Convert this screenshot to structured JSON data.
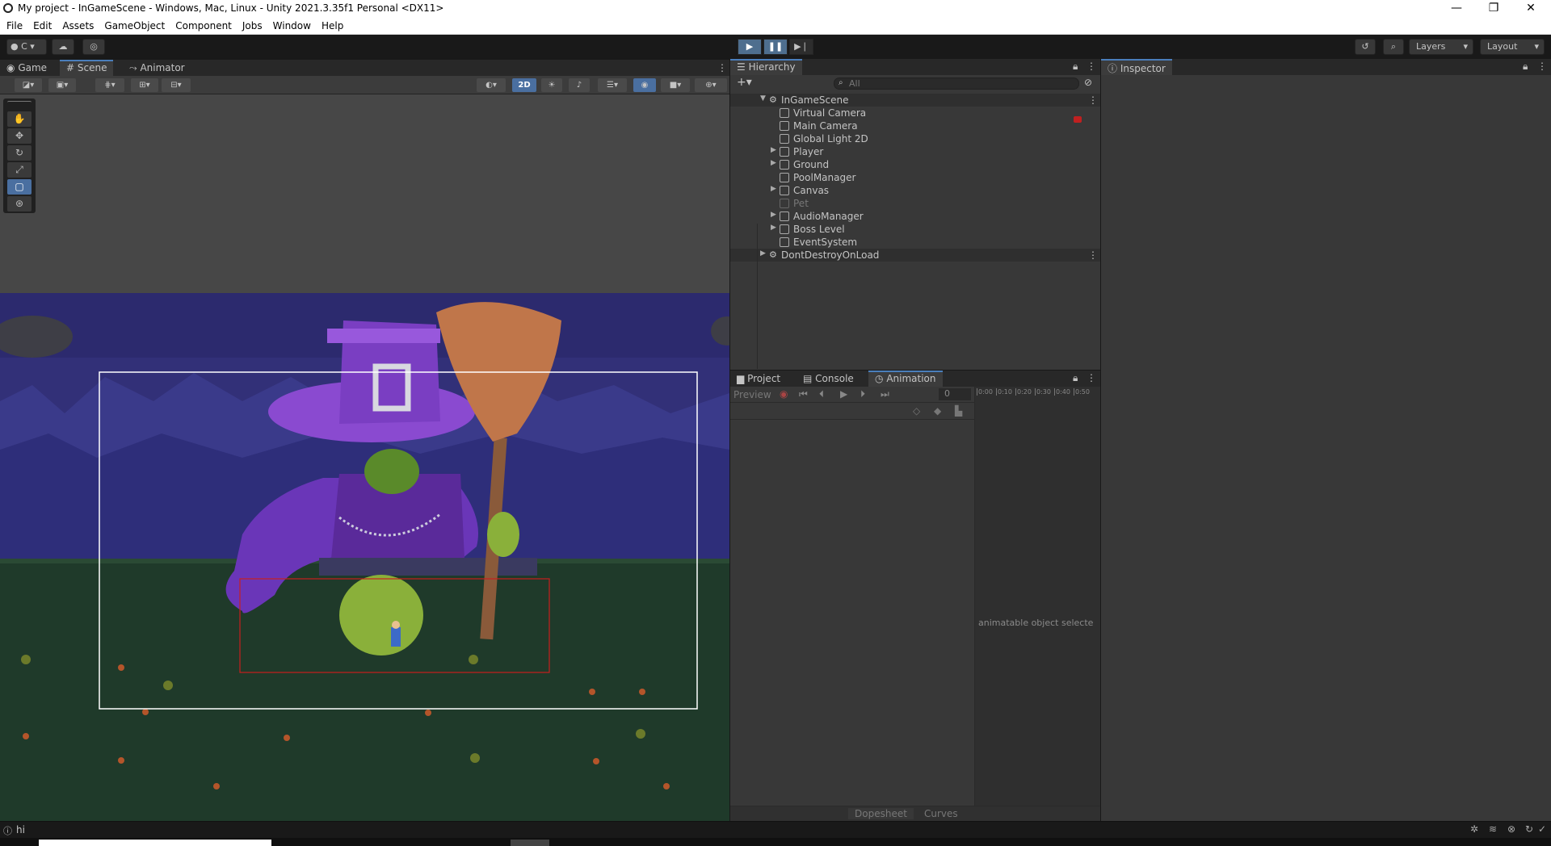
{
  "window": {
    "title": "My project - InGameScene - Windows, Mac, Linux - Unity 2021.3.35f1 Personal <DX11>",
    "minimize": "—",
    "restore": "❐",
    "close": "✕"
  },
  "menu": [
    "File",
    "Edit",
    "Assets",
    "GameObject",
    "Component",
    "Jobs",
    "Window",
    "Help"
  ],
  "toolbar": {
    "account_label": "C",
    "layers_label": "Layers",
    "layout_label": "Layout"
  },
  "scene_tabs": [
    "Game",
    "Scene",
    "Animator"
  ],
  "scene_toolbar": {
    "mode_2d": "2D"
  },
  "hierarchy": {
    "title": "Hierarchy",
    "search_placeholder": "All",
    "scenes": [
      {
        "name": "InGameScene",
        "items": [
          {
            "name": "Virtual Camera",
            "expandable": false,
            "active": true
          },
          {
            "name": "Main Camera",
            "expandable": false,
            "active": true
          },
          {
            "name": "Global Light 2D",
            "expandable": false,
            "active": true
          },
          {
            "name": "Player",
            "expandable": true,
            "active": true
          },
          {
            "name": "Ground",
            "expandable": true,
            "active": true
          },
          {
            "name": "PoolManager",
            "expandable": false,
            "active": true
          },
          {
            "name": "Canvas",
            "expandable": true,
            "active": true
          },
          {
            "name": "Pet",
            "expandable": false,
            "active": false
          },
          {
            "name": "AudioManager",
            "expandable": true,
            "active": true
          },
          {
            "name": "Boss Level",
            "expandable": true,
            "active": true
          },
          {
            "name": "EventSystem",
            "expandable": false,
            "active": true
          }
        ]
      },
      {
        "name": "DontDestroyOnLoad",
        "items": []
      }
    ]
  },
  "bottom_tabs": [
    "Project",
    "Console",
    "Animation"
  ],
  "animation": {
    "preview_label": "Preview",
    "frame_value": "0",
    "timeline_ticks": [
      "0:00",
      "0:10",
      "0:20",
      "0:30",
      "0:40",
      "0:50"
    ],
    "empty_message": "animatable object selecte",
    "dopesheet_tab": "Dopesheet",
    "curves_tab": "Curves"
  },
  "inspector": {
    "title": "Inspector"
  },
  "status": {
    "message": "hi"
  },
  "colors": {
    "accent": "#4a7ebb",
    "selection_rect": "#ffffff",
    "collider_rect": "#c81e1e"
  }
}
